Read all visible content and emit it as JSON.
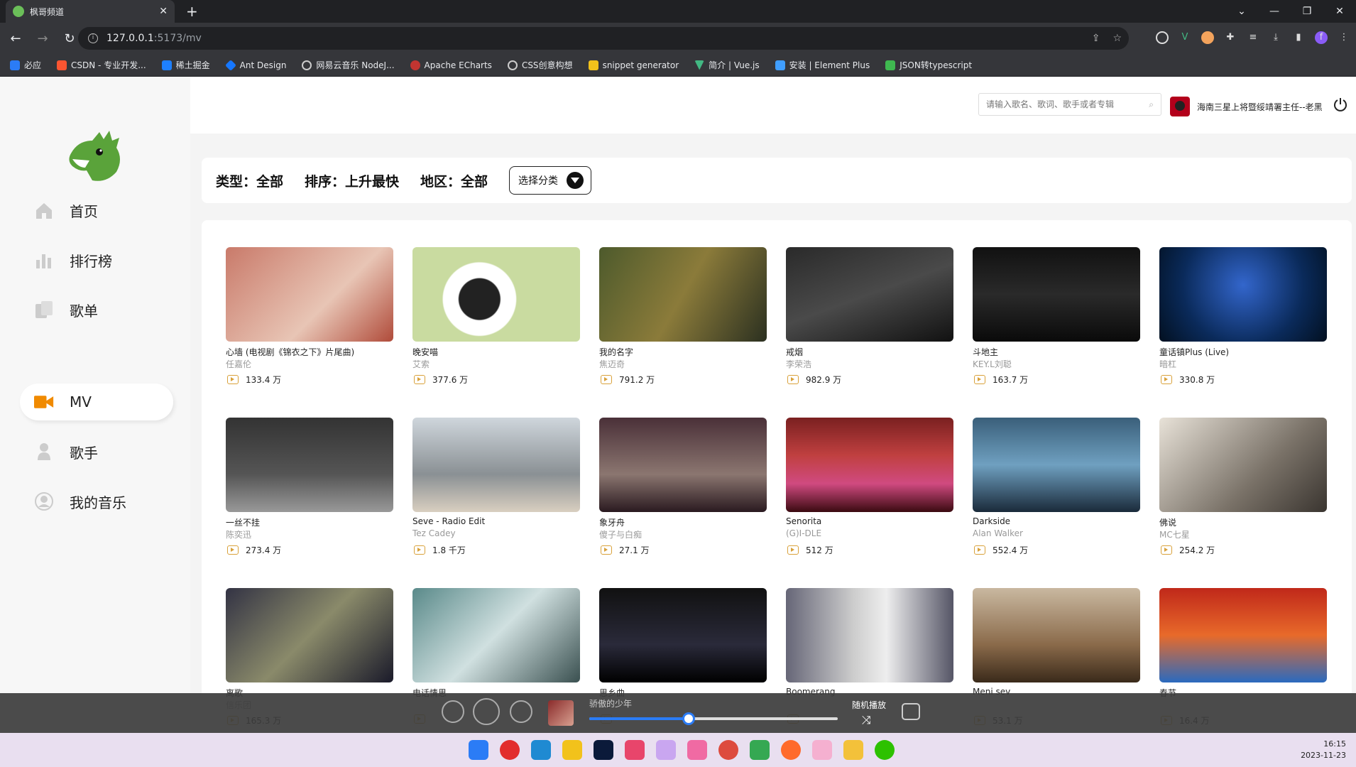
{
  "browser": {
    "tab_title": "枫哥频道",
    "url_host": "127.0.0.1",
    "url_path": ":5173/mv",
    "bookmarks": [
      "必应",
      "CSDN - 专业开发...",
      "稀土掘金",
      "Ant Design",
      "网易云音乐 NodeJ...",
      "Apache ECharts",
      "CSS创意构想",
      "snippet generator",
      "简介 | Vue.js",
      "安装 | Element Plus",
      "JSON转typescript"
    ]
  },
  "sidebar": {
    "items": [
      {
        "label": "首页",
        "icon": "home-icon"
      },
      {
        "label": "排行榜",
        "icon": "chart-icon"
      },
      {
        "label": "歌单",
        "icon": "playlist-icon"
      },
      {
        "label": "MV",
        "icon": "video-icon",
        "active": true
      },
      {
        "label": "歌手",
        "icon": "singer-icon"
      },
      {
        "label": "我的音乐",
        "icon": "user-icon"
      }
    ]
  },
  "header": {
    "search_placeholder": "请输入歌名、歌词、歌手或者专辑",
    "username": "海南三星上将暨绥靖署主任--老黑"
  },
  "filters": {
    "type_label": "类型：全部",
    "sort_label": "排序：上升最快",
    "area_label": "地区：全部",
    "category_button": "选择分类"
  },
  "mvs": [
    {
      "name": "心墙 (电视剧《锦衣之下》片尾曲)",
      "artist": "任嘉伦",
      "plays": "133.4 万"
    },
    {
      "name": "晚安喵",
      "artist": "艾索",
      "plays": "377.6 万"
    },
    {
      "name": "我的名字",
      "artist": "焦迈奇",
      "plays": "791.2 万"
    },
    {
      "name": "戒烟",
      "artist": "李荣浩",
      "plays": "982.9 万"
    },
    {
      "name": "斗地主",
      "artist": "KEY.L刘聪",
      "plays": "163.7 万"
    },
    {
      "name": "童话镇Plus (Live)",
      "artist": "暗杠",
      "plays": "330.8 万"
    },
    {
      "name": "一丝不挂",
      "artist": "陈奕迅",
      "plays": "273.4 万"
    },
    {
      "name": "Seve - Radio Edit",
      "artist": "Tez Cadey",
      "plays": "1.8 千万"
    },
    {
      "name": "象牙舟",
      "artist": "傻子与白痴",
      "plays": "27.1 万"
    },
    {
      "name": "Senorita",
      "artist": "(G)I-DLE",
      "plays": "512 万"
    },
    {
      "name": "Darkside",
      "artist": "Alan Walker",
      "plays": "552.4 万"
    },
    {
      "name": "佛说",
      "artist": "MC七星",
      "plays": "254.2 万"
    },
    {
      "name": "离歌",
      "artist": "信乐团",
      "plays": "165.3 万"
    },
    {
      "name": "电话情思",
      "artist": "",
      "plays": ""
    },
    {
      "name": "思乡曲",
      "artist": "",
      "plays": ""
    },
    {
      "name": "Boomerang",
      "artist": "",
      "plays": ""
    },
    {
      "name": "Meni sev",
      "artist": "",
      "plays": "53.1 万"
    },
    {
      "name": "春节",
      "artist": "",
      "plays": "16.4 万"
    }
  ],
  "player": {
    "title": "骄傲的少年",
    "mode_label": "随机播放",
    "progress": 0.4
  },
  "taskbar": {
    "time": "16:15",
    "date": "2023-11-23"
  },
  "colors": {
    "accent": "#f08a00",
    "progress": "#2b7cf6"
  }
}
